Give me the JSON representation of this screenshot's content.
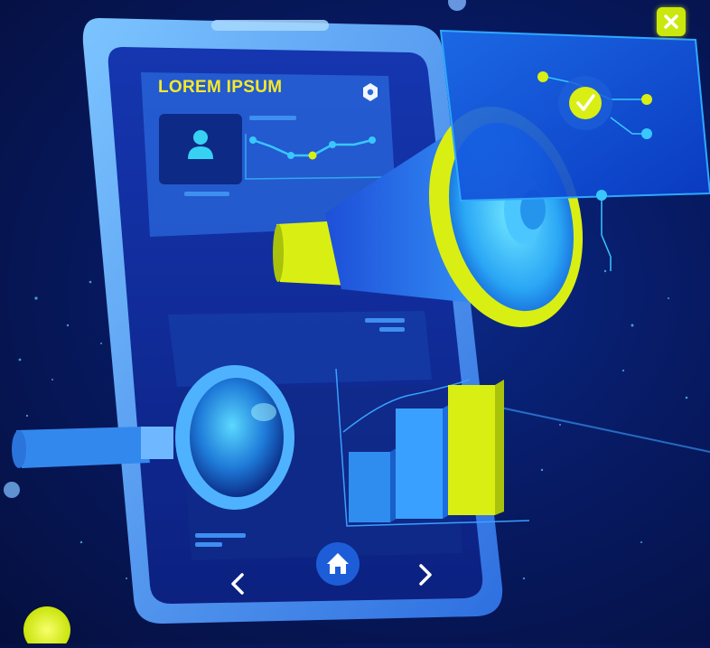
{
  "card": {
    "title": "LOREM IPSUM"
  },
  "icons": {
    "close": "close-icon",
    "settings": "hexagon-icon",
    "user": "user-icon",
    "check": "check-icon",
    "home": "home-icon",
    "prev": "chevron-left-icon",
    "next": "chevron-right-icon"
  },
  "colors": {
    "background": "#06154f",
    "phone_frame": "#4c9ef2",
    "screen": "#0f2b98",
    "accent_yellow": "#d9ef14",
    "accent_cyan": "#43d6ff"
  }
}
